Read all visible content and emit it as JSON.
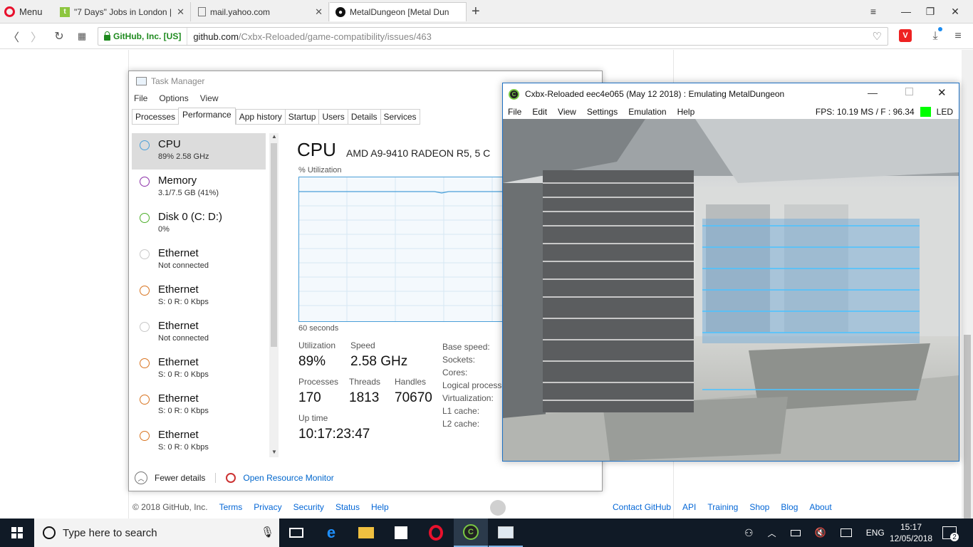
{
  "browser": {
    "menu_label": "Menu",
    "tabs": [
      {
        "title": "\"7 Days\" Jobs in London |",
        "favicon": "t"
      },
      {
        "title": "mail.yahoo.com"
      },
      {
        "title": "MetalDungeon [Metal Dun"
      }
    ],
    "address": {
      "secure_label": "GitHub, Inc. [US]",
      "domain": "github.com",
      "path": "/Cxbx-Reloaded/game-compatibility/issues/463"
    }
  },
  "github_footer": {
    "copyright": "© 2018 GitHub, Inc.",
    "left_links": [
      "Terms",
      "Privacy",
      "Security",
      "Status",
      "Help"
    ],
    "right_links": [
      "Contact GitHub",
      "API",
      "Training",
      "Shop",
      "Blog",
      "About"
    ]
  },
  "task_manager": {
    "title": "Task Manager",
    "menu": [
      "File",
      "Options",
      "View"
    ],
    "tabs": [
      "Processes",
      "Performance",
      "App history",
      "Startup",
      "Users",
      "Details",
      "Services"
    ],
    "sidebar": [
      {
        "name": "CPU",
        "sub": "89%  2.58 GHz",
        "color": "#4a9fd8"
      },
      {
        "name": "Memory",
        "sub": "3.1/7.5 GB (41%)",
        "color": "#8b2fa8"
      },
      {
        "name": "Disk 0 (C: D:)",
        "sub": "0%",
        "color": "#4caf2a"
      },
      {
        "name": "Ethernet",
        "sub": "Not connected",
        "color": "#c0c0c0"
      },
      {
        "name": "Ethernet",
        "sub": "S: 0  R: 0 Kbps",
        "color": "#d8731f"
      },
      {
        "name": "Ethernet",
        "sub": "Not connected",
        "color": "#c0c0c0"
      },
      {
        "name": "Ethernet",
        "sub": "S: 0  R: 0 Kbps",
        "color": "#d8731f"
      },
      {
        "name": "Ethernet",
        "sub": "S: 0  R: 0 Kbps",
        "color": "#d8731f"
      },
      {
        "name": "Ethernet",
        "sub": "S: 0  R: 0 Kbps",
        "color": "#d8731f"
      }
    ],
    "cpu": {
      "heading": "CPU",
      "model": "AMD A9-9410 RADEON R5, 5 C",
      "util_label": "% Utilization",
      "graph_span": "60 seconds",
      "utilization_label": "Utilization",
      "utilization": "89%",
      "speed_label": "Speed",
      "speed": "2.58 GHz",
      "processes_label": "Processes",
      "processes": "170",
      "threads_label": "Threads",
      "threads": "1813",
      "handles_label": "Handles",
      "handles": "70670",
      "uptime_label": "Up time",
      "uptime": "10:17:23:47",
      "specs": [
        "Base speed:",
        "Sockets:",
        "Cores:",
        "Logical processo",
        "Virtualization:",
        "L1 cache:",
        "L2 cache:"
      ]
    },
    "fewer_details": "Fewer details",
    "open_resource_monitor": "Open Resource Monitor"
  },
  "cxbx": {
    "title": "Cxbx-Reloaded eec4e065 (May 12 2018) : Emulating MetalDungeon",
    "menu": [
      "File",
      "Edit",
      "View",
      "Settings",
      "Emulation",
      "Help"
    ],
    "fps": "FPS: 10.19  MS / F : 96.34",
    "led_label": "LED",
    "led_color": "#00ff00"
  },
  "taskbar": {
    "search_placeholder": "Type here to search",
    "lang": "ENG",
    "time": "15:17",
    "date": "12/05/2018",
    "notifications": "2"
  }
}
